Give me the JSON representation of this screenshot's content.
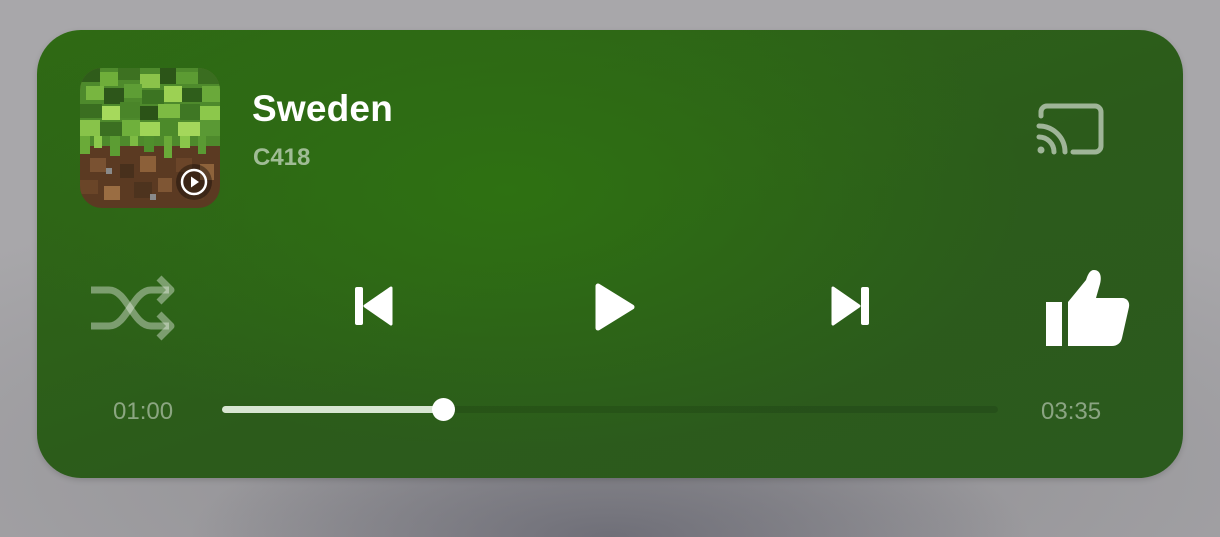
{
  "track": {
    "title": "Sweden",
    "artist": "C418",
    "album_art_icon": "minecraft-grass-block-art",
    "source_badge_icon": "play-circle-icon"
  },
  "controls": {
    "cast_icon": "cast-icon",
    "shuffle_icon": "shuffle-icon",
    "previous_icon": "skip-previous-icon",
    "play_icon": "play-icon",
    "next_icon": "skip-next-icon",
    "like_icon": "thumbs-up-icon"
  },
  "progress": {
    "elapsed": "01:00",
    "total": "03:35",
    "fraction": 0.285
  },
  "colors": {
    "card_background": "#2e6416",
    "progress_fill": "#d8e6d2",
    "muted_text": "#a4b79c"
  }
}
